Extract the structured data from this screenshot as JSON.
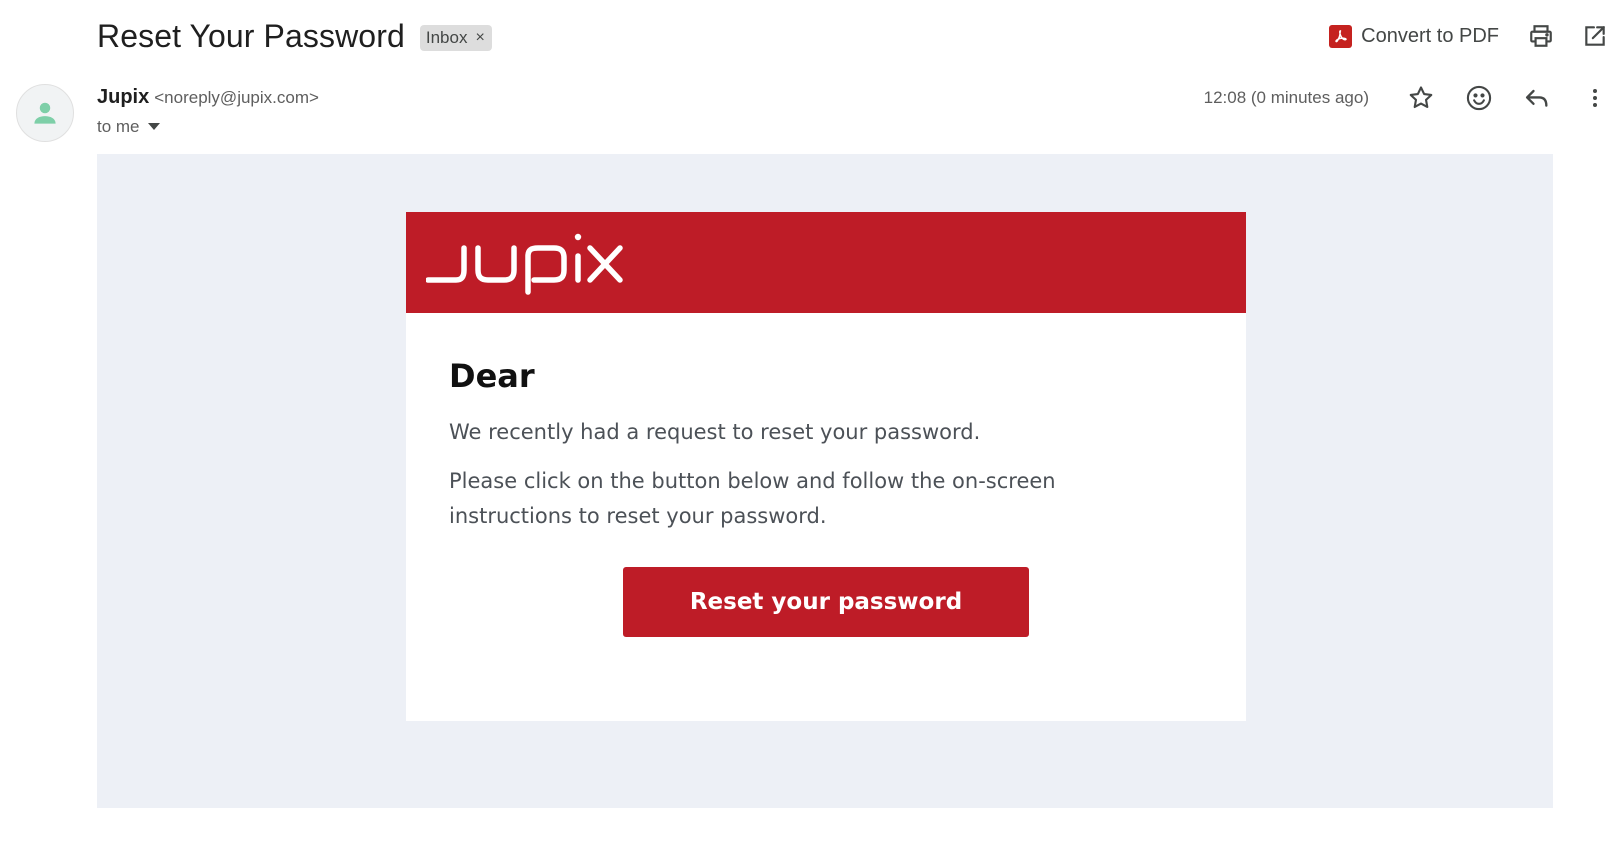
{
  "subject": {
    "title": "Reset Your Password",
    "label": "Inbox",
    "label_remove": "×"
  },
  "toolbar": {
    "convert_pdf_label": "Convert to PDF",
    "print_icon": "print-icon",
    "open_new_window_icon": "open-in-new-icon"
  },
  "sender": {
    "name": "Jupix",
    "email": "<noreply@jupix.com>",
    "to_label": "to me",
    "avatar_icon": "person-icon"
  },
  "meta": {
    "timestamp": "12:08 (0 minutes ago)",
    "icons": [
      "star-icon",
      "emoji-icon",
      "reply-icon",
      "more-vert-icon"
    ]
  },
  "email": {
    "brand": "jupix",
    "greeting": "Dear",
    "paragraph_1": "We recently had a request to reset your password.",
    "paragraph_2": "Please click on the button below and follow the on-screen instructions to reset your password.",
    "cta_label": "Reset your password"
  },
  "colors": {
    "brand_red": "#be1c27",
    "body_bg": "#edf0f6",
    "pdf_red": "#c5221f",
    "avatar_green": "#7ecfa8"
  }
}
